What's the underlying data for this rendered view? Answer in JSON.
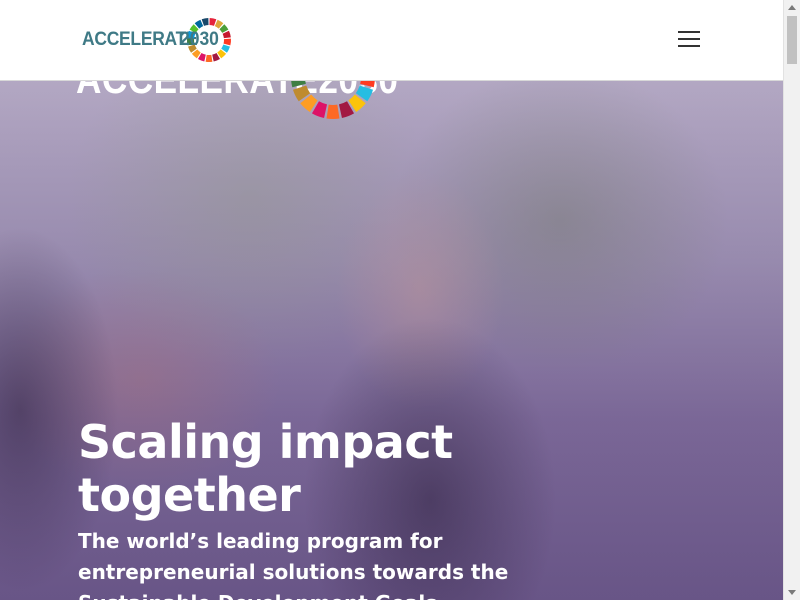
{
  "header": {
    "logo_text": "ACCELERATE",
    "logo_year": "2030",
    "menu_icon": "hamburger-menu-icon"
  },
  "hero": {
    "background_logo_text": "ACCELERATE2030",
    "headline": "Scaling impact together",
    "subheadline": "The world’s leading program for entrepreneurial solutions towards the Sustainable Development Goals"
  },
  "colors": {
    "logo_teal": "#3f7a86",
    "sdg_wheel": [
      "#e5243b",
      "#dda63a",
      "#4c9f38",
      "#c5192d",
      "#ff3a21",
      "#26bde2",
      "#fcc30b",
      "#a21942",
      "#fd6925",
      "#dd1367",
      "#fd9d24",
      "#bf8b2e",
      "#3f7e44",
      "#0a97d9",
      "#56c02b",
      "#00689d",
      "#19486a"
    ]
  }
}
